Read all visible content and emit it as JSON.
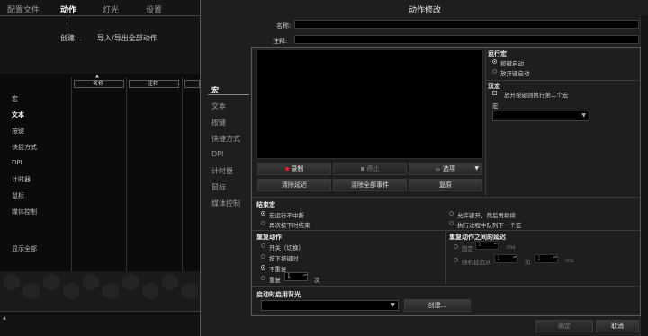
{
  "background_app": {
    "nav_tabs": [
      "配置文件",
      "动作",
      "灯光",
      "设置"
    ],
    "links": {
      "create": "创建...",
      "import_export": "导入/导出全部动作"
    },
    "columns": [
      "名称",
      "注释"
    ],
    "categories": [
      "宏",
      "文本",
      "按键",
      "快捷方式",
      "DPI",
      "计时器",
      "鼠标",
      "媒体控制"
    ],
    "show_all": "显示全部"
  },
  "dialog": {
    "title": "动作修改",
    "name_label": "名称:",
    "name_value": "",
    "note_label": "注释:",
    "note_value": "",
    "subnav": [
      "宏",
      "文本",
      "按键",
      "快捷方式",
      "DPI",
      "计时器",
      "鼠标",
      "媒体控制"
    ],
    "buttons": {
      "record": "录制",
      "stop": "停止",
      "options": "选项",
      "clear_delays": "清除延迟",
      "clear_all_events": "清除全部事件",
      "reset": "复原",
      "create": "创建...",
      "ok": "确定",
      "cancel": "取消"
    },
    "run_macro": {
      "title": "运行宏",
      "on_press": "按键启动",
      "on_release": "放开键启动"
    },
    "double_macro": {
      "title": "双宏",
      "checkbox": "放开按键则执行第二个宏",
      "macro_label": "宏"
    },
    "end_macro": {
      "title": "结束宏",
      "opt1": "宏运行不中断",
      "opt2": "再次按下时结束",
      "opt3": "允许键开，然后再继续",
      "opt4": "执行过程中队列下一个宏"
    },
    "repeat": {
      "title": "重复动作",
      "toggle": "开关（切换）",
      "while_pressed": "按下按键时",
      "no_repeat": "不重复",
      "repeat_label": "重复",
      "repeat_count": "1",
      "times": "次"
    },
    "repeat_delay": {
      "title": "重复动作之间的延迟",
      "fixed_label": "固定",
      "fixed_value": "1",
      "ms": "ms",
      "random_label": "随机延迟从",
      "random_from": "1",
      "and": "和",
      "random_to": "1",
      "ms2": "ms"
    },
    "startup_light": {
      "title": "启动时启用背光",
      "selected": ""
    }
  },
  "colors": {
    "record_dot": "#e02020",
    "accent": "#ffffff"
  },
  "icons": [
    "stop-square-icon",
    "options-icon",
    "dropdown-chevron-icon",
    "collapse-arrow-icon",
    "sort-arrow-icon"
  ]
}
